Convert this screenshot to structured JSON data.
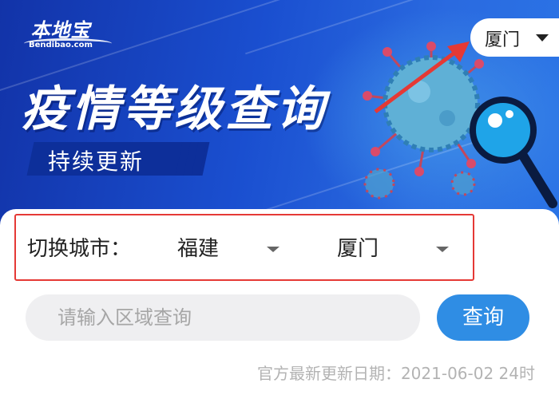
{
  "banner": {
    "logo_cn": "本地宝",
    "logo_en": "Bendibao.com",
    "title": "疫情等级查询",
    "subtitle": "持续更新",
    "city_selector": {
      "value": "厦门",
      "icon": "caret-down-icon"
    },
    "colors": {
      "bg": "#1a4fd0",
      "accent": "#e53935"
    }
  },
  "switch": {
    "label": "切换城市：",
    "province": "福建",
    "city": "厦门"
  },
  "search": {
    "placeholder": "请输入区域查询",
    "button_label": "查询",
    "button_color": "#2f8de4"
  },
  "update_info": "官方最新更新日期：2021-06-02 24时"
}
